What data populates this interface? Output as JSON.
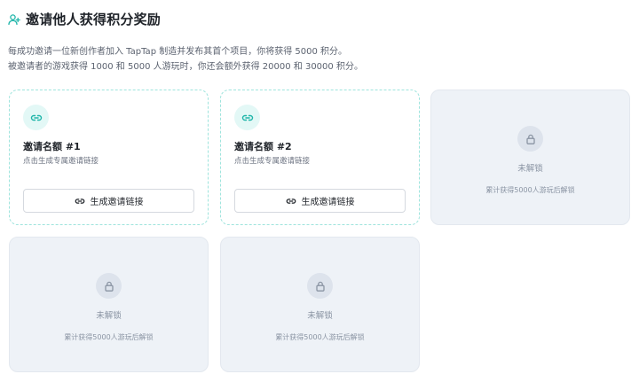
{
  "header": {
    "icon": "add-user-icon",
    "title": "邀请他人获得积分奖励",
    "accent_color": "#1fb5a9"
  },
  "description": {
    "line1": "每成功邀请一位新创作者加入 TapTap 制造并发布其首个项目，你将获得 5000 积分。",
    "line2": "被邀请者的游戏获得 1000 和 5000 人游玩时，你还会额外获得 20000 和 30000 积分。"
  },
  "cards": [
    {
      "state": "unlocked",
      "icon": "link-icon",
      "title": "邀请名额 #1",
      "subtitle": "点击生成专属邀请链接",
      "button_label": "生成邀请链接"
    },
    {
      "state": "unlocked",
      "icon": "link-icon",
      "title": "邀请名额 #2",
      "subtitle": "点击生成专属邀请链接",
      "button_label": "生成邀请链接"
    },
    {
      "state": "locked",
      "icon": "lock-icon",
      "title": "未解锁",
      "subtitle": "累计获得5000人游玩后解锁"
    },
    {
      "state": "locked",
      "icon": "lock-icon",
      "title": "未解锁",
      "subtitle": "累计获得5000人游玩后解锁"
    },
    {
      "state": "locked",
      "icon": "lock-icon",
      "title": "未解锁",
      "subtitle": "累计获得5000人游玩后解锁"
    }
  ]
}
